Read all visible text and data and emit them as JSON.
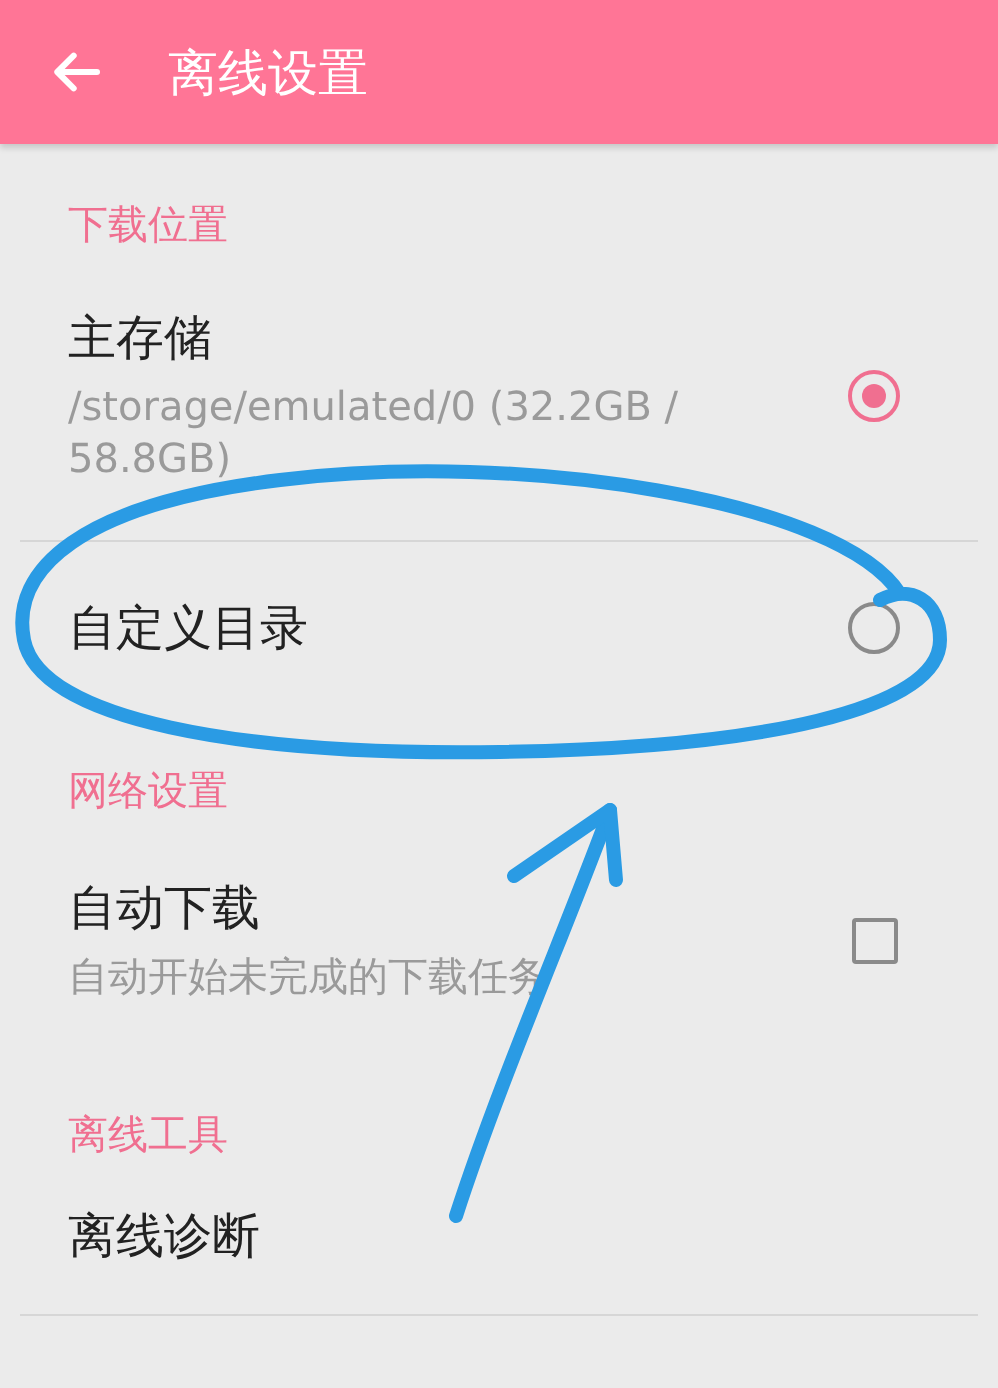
{
  "app_bar": {
    "title": "离线设置"
  },
  "sections": [
    {
      "header": "下载位置",
      "items": [
        {
          "kind": "radio",
          "title": "主存储",
          "subtitle": "/storage/emulated/0 (32.2GB / 58.8GB)",
          "selected": true,
          "divider": true
        },
        {
          "kind": "radio",
          "title": "自定义目录",
          "selected": false
        }
      ]
    },
    {
      "header": "网络设置",
      "items": [
        {
          "kind": "checkbox",
          "title": "自动下载",
          "subtitle": "自动开始未完成的下载任务",
          "checked": false
        }
      ]
    },
    {
      "header": "离线工具",
      "items": [
        {
          "kind": "plain",
          "title": "离线诊断",
          "divider": true
        }
      ]
    }
  ]
}
